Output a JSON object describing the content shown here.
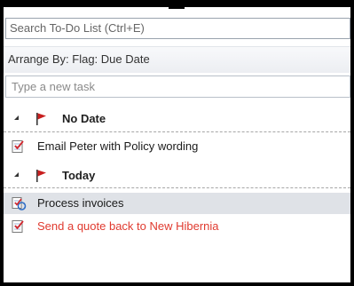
{
  "search": {
    "placeholder": "Search To-Do List (Ctrl+E)"
  },
  "arrange": {
    "label": "Arrange By: Flag: Due Date"
  },
  "new_task": {
    "placeholder": "Type a new task"
  },
  "groups": [
    {
      "label": "No Date",
      "tasks": [
        {
          "label": "Email Peter with Policy wording",
          "icon": "task-icon",
          "selected": false,
          "overdue": false
        }
      ]
    },
    {
      "label": "Today",
      "tasks": [
        {
          "label": "Process invoices",
          "icon": "task-icon",
          "selected": true,
          "overdue": false
        },
        {
          "label": "Send a quote back to New Hibernia",
          "icon": "task-icon",
          "selected": false,
          "overdue": true
        }
      ]
    }
  ],
  "colors": {
    "flag": "#c81e1e",
    "overdue_text": "#e03a2f",
    "selection": "#dfe2e7"
  }
}
